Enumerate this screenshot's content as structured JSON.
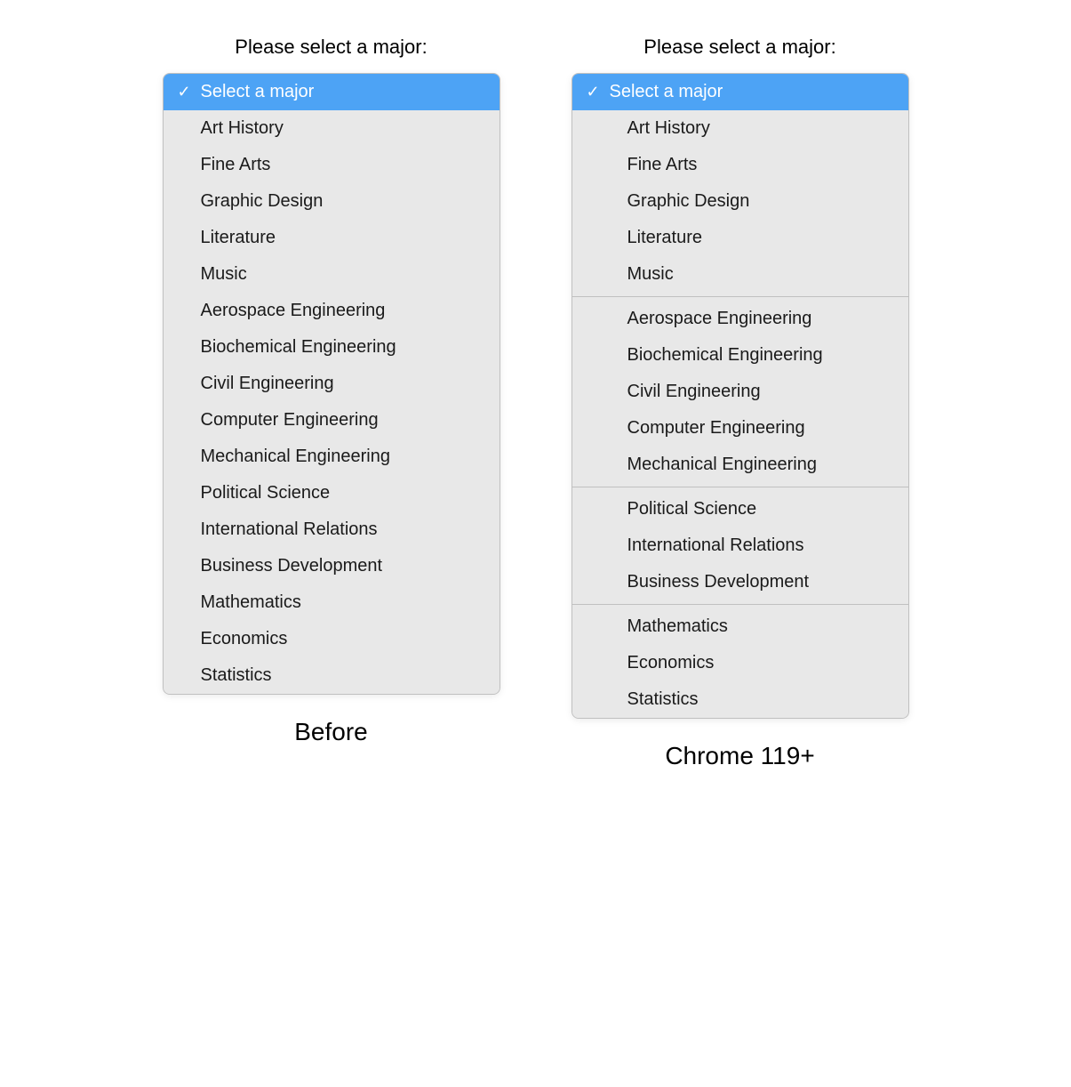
{
  "before": {
    "label": "Please select a major:",
    "caption": "Before",
    "options": [
      {
        "id": "placeholder",
        "text": "Select a major",
        "selected": true,
        "check": true
      },
      {
        "id": "art-history",
        "text": "Art History"
      },
      {
        "id": "fine-arts",
        "text": "Fine Arts"
      },
      {
        "id": "graphic-design",
        "text": "Graphic Design"
      },
      {
        "id": "literature",
        "text": "Literature"
      },
      {
        "id": "music",
        "text": "Music"
      },
      {
        "id": "aerospace-engineering",
        "text": "Aerospace Engineering"
      },
      {
        "id": "biochemical-engineering",
        "text": "Biochemical Engineering"
      },
      {
        "id": "civil-engineering",
        "text": "Civil Engineering"
      },
      {
        "id": "computer-engineering",
        "text": "Computer Engineering"
      },
      {
        "id": "mechanical-engineering",
        "text": "Mechanical Engineering"
      },
      {
        "id": "political-science",
        "text": "Political Science"
      },
      {
        "id": "international-relations",
        "text": "International Relations"
      },
      {
        "id": "business-development",
        "text": "Business Development"
      },
      {
        "id": "mathematics",
        "text": "Mathematics"
      },
      {
        "id": "economics",
        "text": "Economics"
      },
      {
        "id": "statistics",
        "text": "Statistics"
      }
    ]
  },
  "after": {
    "label": "Please select a major:",
    "caption": "Chrome 119+",
    "placeholder": {
      "text": "Select a major",
      "check": true
    },
    "groups": [
      {
        "id": "group-arts",
        "items": [
          {
            "id": "art-history",
            "text": "Art History"
          },
          {
            "id": "fine-arts",
            "text": "Fine Arts"
          },
          {
            "id": "graphic-design",
            "text": "Graphic Design"
          },
          {
            "id": "literature",
            "text": "Literature"
          },
          {
            "id": "music",
            "text": "Music"
          }
        ]
      },
      {
        "id": "group-engineering",
        "items": [
          {
            "id": "aerospace-engineering",
            "text": "Aerospace Engineering"
          },
          {
            "id": "biochemical-engineering",
            "text": "Biochemical Engineering"
          },
          {
            "id": "civil-engineering",
            "text": "Civil Engineering"
          },
          {
            "id": "computer-engineering",
            "text": "Computer Engineering"
          },
          {
            "id": "mechanical-engineering",
            "text": "Mechanical Engineering"
          }
        ]
      },
      {
        "id": "group-social",
        "items": [
          {
            "id": "political-science",
            "text": "Political Science"
          },
          {
            "id": "international-relations",
            "text": "International Relations"
          },
          {
            "id": "business-development",
            "text": "Business Development"
          }
        ]
      },
      {
        "id": "group-math",
        "items": [
          {
            "id": "mathematics",
            "text": "Mathematics"
          },
          {
            "id": "economics",
            "text": "Economics"
          },
          {
            "id": "statistics",
            "text": "Statistics"
          }
        ]
      }
    ]
  }
}
